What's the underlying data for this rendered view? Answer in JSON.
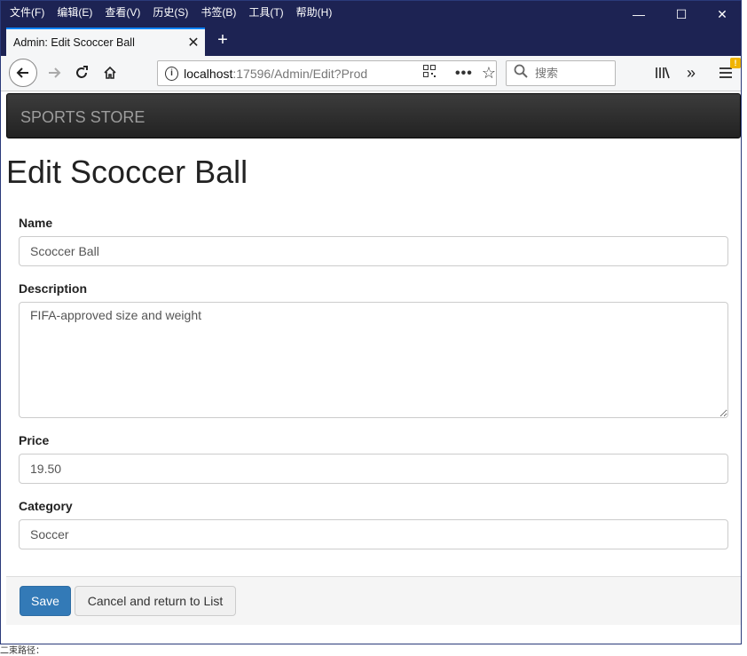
{
  "menu": [
    "文件(F)",
    "编辑(E)",
    "查看(V)",
    "历史(S)",
    "书签(B)",
    "工具(T)",
    "帮助(H)"
  ],
  "window_controls": {
    "minimize": "—",
    "maximize": "☐",
    "close": "✕"
  },
  "tab": {
    "title": "Admin: Edit Scoccer Ball"
  },
  "url": {
    "host": "localhost",
    "path": ":17596/Admin/Edit?Prod"
  },
  "search": {
    "placeholder": "搜索"
  },
  "brand": "SPORTS STORE",
  "heading": "Edit Scoccer Ball",
  "form": {
    "name_label": "Name",
    "name_value": "Scoccer Ball",
    "description_label": "Description",
    "description_value": "FIFA-approved size and weight",
    "price_label": "Price",
    "price_value": "19.50",
    "category_label": "Category",
    "category_value": "Soccer"
  },
  "buttons": {
    "save": "Save",
    "cancel": "Cancel and return to List"
  },
  "background_text": "二束路径：",
  "colors": {
    "titlebar": "#1d2353",
    "primary": "#337ab7",
    "navbar": "#222222",
    "notification": "#f0b400"
  },
  "icons": [
    "back-icon",
    "forward-icon",
    "reload-icon",
    "home-icon",
    "info-icon",
    "qr-code-icon",
    "more-icon",
    "star-icon",
    "search-icon",
    "library-icon",
    "overflow-icon",
    "hamburger-menu-icon"
  ]
}
